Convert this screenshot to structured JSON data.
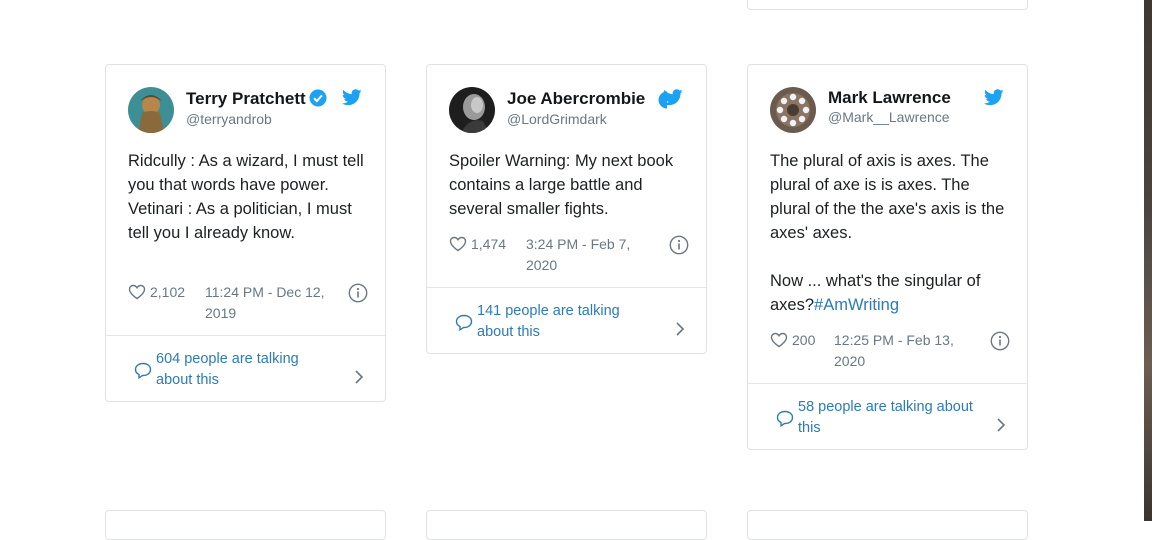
{
  "colors": {
    "link": "#2b7bb9",
    "twitter_blue": "#1da1f2",
    "text": "#1c2022",
    "muted": "#697882",
    "border": "#dfe3e6"
  },
  "tweets": [
    {
      "name": "Terry Pratchett",
      "handle": "@terryandrob",
      "verified": true,
      "text_lines": [
        "Ridcully : As a wizard, I must tell you that words have power.",
        "Vetinari : As a politician, I must tell you I already know."
      ],
      "likes": "2,102",
      "datetime": "11:24 PM - Dec 12, 2019",
      "conversation": "604 people are talking about this",
      "icons": {
        "like": "heart-icon",
        "info": "info-icon",
        "reply": "speech-bubble-icon",
        "more": "chevron-right-icon",
        "brand": "twitter-bird-icon"
      }
    },
    {
      "name": "Joe Abercrombie",
      "handle": "@LordGrimdark",
      "verified": true,
      "text_lines": [
        "Spoiler Warning: My next book contains a large battle and several smaller fights."
      ],
      "likes": "1,474",
      "datetime": "3:24 PM - Feb 7, 2020",
      "conversation": "141 people are talking about this",
      "icons": {
        "like": "heart-icon",
        "info": "info-icon",
        "reply": "speech-bubble-icon",
        "more": "chevron-right-icon",
        "brand": "twitter-bird-icon"
      }
    },
    {
      "name": "Mark Lawrence",
      "handle": "@Mark__Lawrence",
      "verified": false,
      "text_lines": [
        "The plural of axis is axes. The plural of axe is is axes. The plural of the the axe's axis is the axes' axes."
      ],
      "text_after_break": "Now ... what's the singular of axes?",
      "hashtag": "#AmWriting",
      "likes": "200",
      "datetime": "12:25 PM - Feb 13, 2020",
      "conversation": "58 people are talking about this",
      "icons": {
        "like": "heart-icon",
        "info": "info-icon",
        "reply": "speech-bubble-icon",
        "more": "chevron-right-icon",
        "brand": "twitter-bird-icon"
      }
    }
  ]
}
